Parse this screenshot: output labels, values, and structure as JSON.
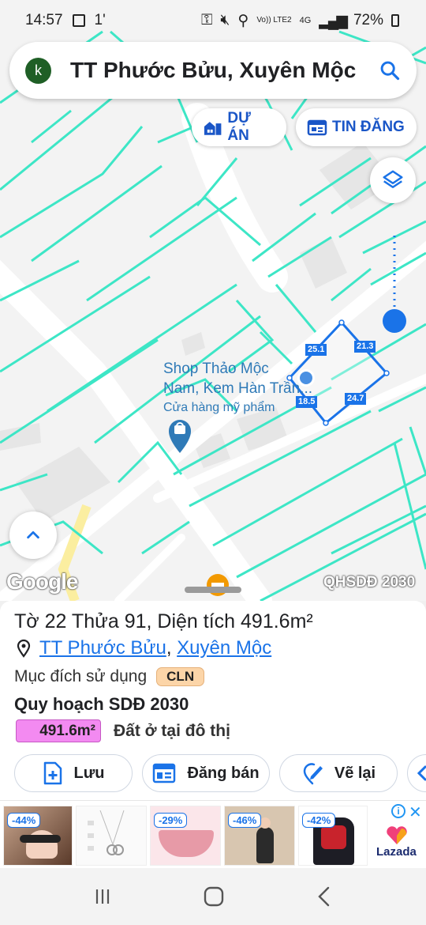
{
  "status_bar": {
    "time": "14:57",
    "extra": "1'",
    "network": "Vo)) LTE2",
    "network_type": "4G",
    "battery": "72%"
  },
  "search": {
    "avatar_letter": "k",
    "query": "TT Phước Bửu, Xuyên Mộc"
  },
  "chips": {
    "du_an": "DỰ ÁN",
    "tin_dang": "TIN ĐĂNG"
  },
  "map": {
    "poi_name_line1": "Shop Thảo Mộc",
    "poi_name_line2": "Nam, Kem Hàn Trần...",
    "poi_category": "Cửa hàng mỹ phẩm",
    "segments": {
      "a": "25.1",
      "b": "21.3",
      "c": "18.5",
      "d": "24.7"
    },
    "google_logo": "Google",
    "overlay_label": "QHSDĐ 2030",
    "parcel_color": "#1a73e8",
    "lot_line_color": "#3de6c6"
  },
  "sheet": {
    "to_label": "Tờ ",
    "to_value": "22",
    "thua_label": " Thửa ",
    "thua_value": "91",
    "dt_label": ", Diện tích ",
    "dt_value": "491.6m²",
    "ward": "TT Phước Bửu",
    "sep": ",",
    "district": "Xuyên Mộc",
    "purpose_label": "Mục đích sử dụng",
    "purpose_code": "CLN",
    "plan_title": "Quy hoạch SDĐ 2030",
    "plan_area": "491.6m²",
    "plan_area_color": "#f38af1",
    "plan_use": "Đất ở tại đô thị",
    "actions": {
      "save": "Lưu",
      "sell": "Đăng bán",
      "redraw": "Vẽ lại"
    }
  },
  "ads": {
    "items": [
      "-44%",
      "-29%",
      "-46%",
      "-42%"
    ],
    "brand": "Lazada"
  }
}
